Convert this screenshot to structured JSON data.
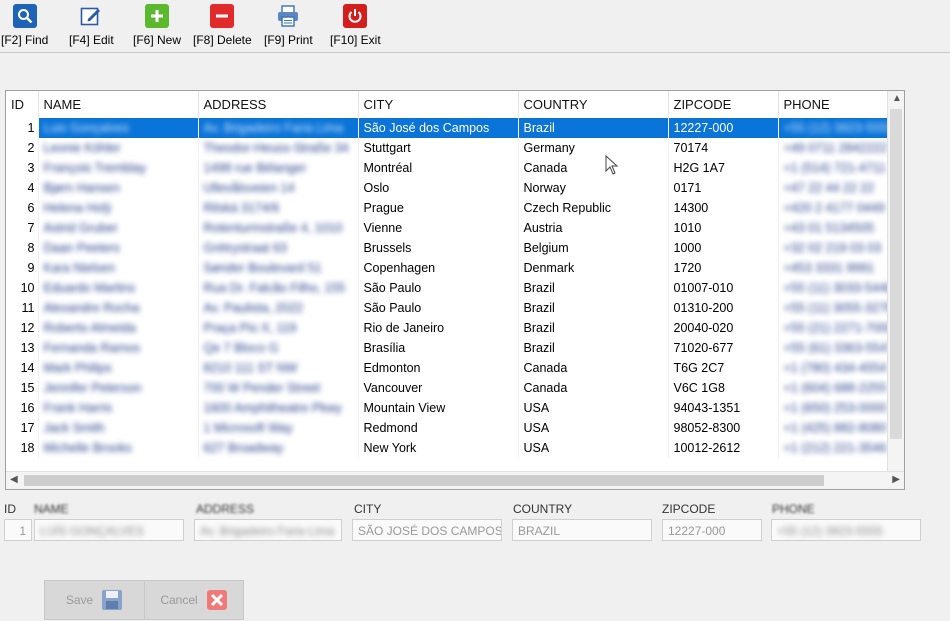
{
  "toolbar": {
    "find": "[F2] Find",
    "edit": "[F4] Edit",
    "new": "[F6] New",
    "delete": "[F8] Delete",
    "print": "[F9] Print",
    "exit": "[F10] Exit"
  },
  "colors": {
    "accent": "#0a74d8",
    "find": "#1e63b5",
    "new": "#5cb82c",
    "delete": "#e12a2a",
    "exit": "#d41d1d"
  },
  "grid": {
    "columns": [
      "ID",
      "NAME",
      "ADDRESS",
      "CITY",
      "COUNTRY",
      "ZIPCODE",
      "PHONE"
    ],
    "rows": [
      {
        "id": "1",
        "name": "Luis Gonçalves",
        "address": "Av. Brigadeiro Faria Lima",
        "city": "São José dos Campos",
        "country": "Brazil",
        "zip": "12227-000",
        "phone": "+55 (12) 3923-5555"
      },
      {
        "id": "2",
        "name": "Leonie Köhler",
        "address": "Theodor-Heuss-Straße 34",
        "city": "Stuttgart",
        "country": "Germany",
        "zip": "70174",
        "phone": "+49 0711 2842222"
      },
      {
        "id": "3",
        "name": "François Tremblay",
        "address": "1498 rue Bélanger",
        "city": "Montréal",
        "country": "Canada",
        "zip": "H2G 1A7",
        "phone": "+1 (514) 721-4711"
      },
      {
        "id": "4",
        "name": "Bjørn Hansen",
        "address": "Ullevålsveien 14",
        "city": "Oslo",
        "country": "Norway",
        "zip": "0171",
        "phone": "+47 22 44 22 22"
      },
      {
        "id": "6",
        "name": "Helena Holý",
        "address": "Rilská 3174/6",
        "city": "Prague",
        "country": "Czech Republic",
        "zip": "14300",
        "phone": "+420 2 4177 0449"
      },
      {
        "id": "7",
        "name": "Astrid Gruber",
        "address": "Rotenturmstraße 4, 1010",
        "city": "Vienne",
        "country": "Austria",
        "zip": "1010",
        "phone": "+43 01 5134505"
      },
      {
        "id": "8",
        "name": "Daan Peeters",
        "address": "Grétrystraat 63",
        "city": "Brussels",
        "country": "Belgium",
        "zip": "1000",
        "phone": "+32 02 219 03 03"
      },
      {
        "id": "9",
        "name": "Kara Nielsen",
        "address": "Sønder Boulevard 51",
        "city": "Copenhagen",
        "country": "Denmark",
        "zip": "1720",
        "phone": "+453 3331 9991"
      },
      {
        "id": "10",
        "name": "Eduardo Martins",
        "address": "Rua Dr. Falcão Filho, 155",
        "city": "São Paulo",
        "country": "Brazil",
        "zip": "01007-010",
        "phone": "+55 (11) 3033-5446"
      },
      {
        "id": "11",
        "name": "Alexandre Rocha",
        "address": "Av. Paulista, 2022",
        "city": "São Paulo",
        "country": "Brazil",
        "zip": "01310-200",
        "phone": "+55 (11) 3055-3278"
      },
      {
        "id": "12",
        "name": "Roberto Almeida",
        "address": "Praça Pio X, 119",
        "city": "Rio de Janeiro",
        "country": "Brazil",
        "zip": "20040-020",
        "phone": "+55 (21) 2271-7000"
      },
      {
        "id": "13",
        "name": "Fernanda Ramos",
        "address": "Qe 7 Bloco G",
        "city": "Brasília",
        "country": "Brazil",
        "zip": "71020-677",
        "phone": "+55 (61) 3363-5547"
      },
      {
        "id": "14",
        "name": "Mark Philips",
        "address": "8210 111 ST NW",
        "city": "Edmonton",
        "country": "Canada",
        "zip": "T6G 2C7",
        "phone": "+1 (780) 434-4554"
      },
      {
        "id": "15",
        "name": "Jennifer Peterson",
        "address": "700 W Pender Street",
        "city": "Vancouver",
        "country": "Canada",
        "zip": "V6C 1G8",
        "phone": "+1 (604) 688-2255"
      },
      {
        "id": "16",
        "name": "Frank Harris",
        "address": "1600 Amphitheatre Pkwy",
        "city": "Mountain View",
        "country": "USA",
        "zip": "94043-1351",
        "phone": "+1 (650) 253-0000"
      },
      {
        "id": "17",
        "name": "Jack Smith",
        "address": "1 Microsoft Way",
        "city": "Redmond",
        "country": "USA",
        "zip": "98052-8300",
        "phone": "+1 (425) 882-8080"
      },
      {
        "id": "18",
        "name": "Michelle Brooks",
        "address": "627 Broadway",
        "city": "New York",
        "country": "USA",
        "zip": "10012-2612",
        "phone": "+1 (212) 221-3546"
      }
    ]
  },
  "edit_form": {
    "labels": {
      "id": "ID",
      "name": "NAME",
      "address": "ADDRESS",
      "city": "CITY",
      "country": "COUNTRY",
      "zipcode": "ZIPCODE",
      "phone": "PHONE"
    },
    "values": {
      "id": "1",
      "name": "LUÍS GONÇALVES",
      "address": "Av. Brigadeiro Faria Lima",
      "city": "SÃO JOSÉ DOS CAMPOS",
      "country": "BRAZIL",
      "zipcode": "12227-000",
      "phone": "+55 (12) 3923-5555"
    }
  },
  "buttons": {
    "save": "Save",
    "cancel": "Cancel"
  }
}
